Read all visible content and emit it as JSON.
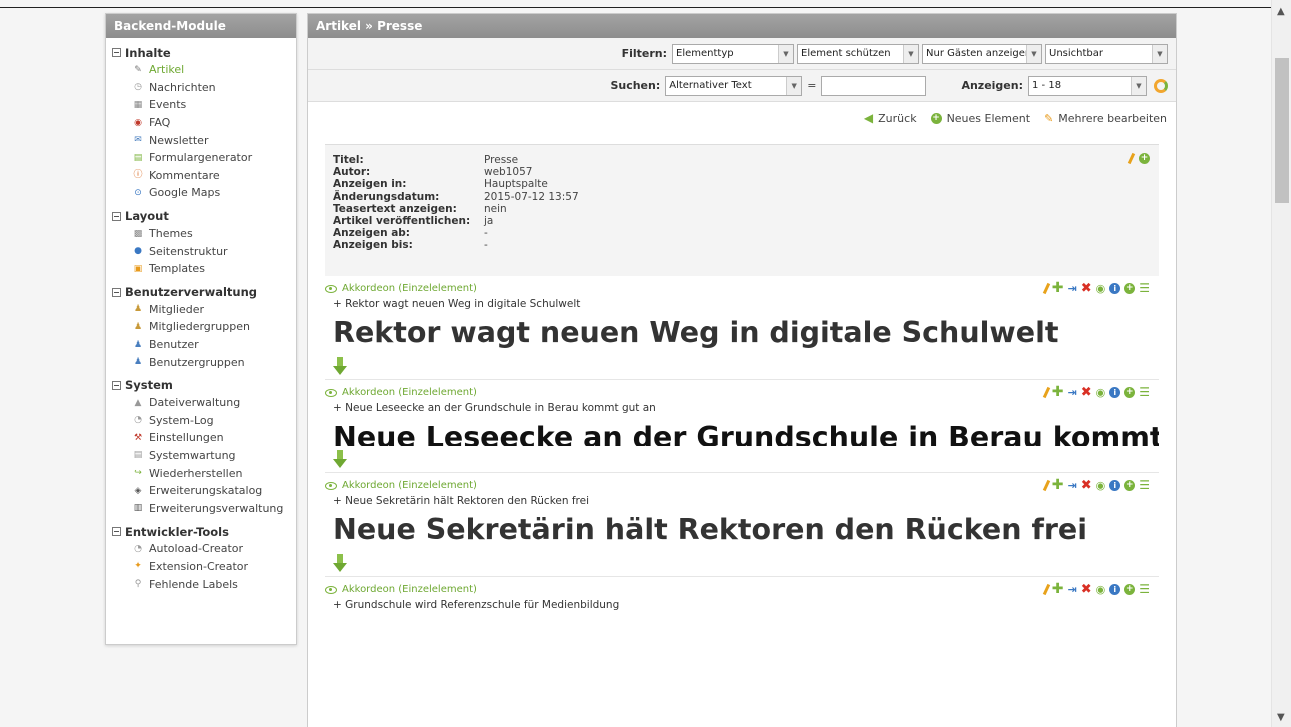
{
  "sidebar": {
    "title": "Backend-Module",
    "groups": [
      {
        "title": "Inhalte",
        "items": [
          {
            "label": "Artikel",
            "icon": "article-icon",
            "active": true
          },
          {
            "label": "Nachrichten",
            "icon": "news-icon"
          },
          {
            "label": "Events",
            "icon": "calendar-icon"
          },
          {
            "label": "FAQ",
            "icon": "faq-icon"
          },
          {
            "label": "Newsletter",
            "icon": "newsletter-icon"
          },
          {
            "label": "Formulargenerator",
            "icon": "form-icon"
          },
          {
            "label": "Kommentare",
            "icon": "comments-icon"
          },
          {
            "label": "Google Maps",
            "icon": "maps-icon"
          }
        ]
      },
      {
        "title": "Layout",
        "items": [
          {
            "label": "Themes",
            "icon": "themes-icon"
          },
          {
            "label": "Seitenstruktur",
            "icon": "site-structure-icon"
          },
          {
            "label": "Templates",
            "icon": "templates-icon"
          }
        ]
      },
      {
        "title": "Benutzerverwaltung",
        "items": [
          {
            "label": "Mitglieder",
            "icon": "member-icon"
          },
          {
            "label": "Mitgliedergruppen",
            "icon": "member-groups-icon"
          },
          {
            "label": "Benutzer",
            "icon": "user-icon"
          },
          {
            "label": "Benutzergruppen",
            "icon": "user-groups-icon"
          }
        ]
      },
      {
        "title": "System",
        "items": [
          {
            "label": "Dateiverwaltung",
            "icon": "files-icon"
          },
          {
            "label": "System-Log",
            "icon": "log-icon"
          },
          {
            "label": "Einstellungen",
            "icon": "settings-icon"
          },
          {
            "label": "Systemwartung",
            "icon": "maintenance-icon"
          },
          {
            "label": "Wiederherstellen",
            "icon": "restore-icon"
          },
          {
            "label": "Erweiterungskatalog",
            "icon": "extension-catalog-icon"
          },
          {
            "label": "Erweiterungsverwaltung",
            "icon": "extension-manager-icon"
          }
        ]
      },
      {
        "title": "Entwickler-Tools",
        "items": [
          {
            "label": "Autoload-Creator",
            "icon": "autoload-icon"
          },
          {
            "label": "Extension-Creator",
            "icon": "extension-creator-icon"
          },
          {
            "label": "Fehlende Labels",
            "icon": "labels-icon"
          }
        ]
      }
    ]
  },
  "main": {
    "title": "Artikel » Presse",
    "filter": {
      "label": "Filtern:",
      "selects": [
        "Elementtyp",
        "Element schützen",
        "Nur Gästen anzeigen",
        "Unsichtbar"
      ]
    },
    "search": {
      "label": "Suchen:",
      "field": "Alternativer Text",
      "equals": "=",
      "value": "",
      "show_label": "Anzeigen:",
      "show_value": "1 - 18"
    },
    "actions": {
      "back": "Zurück",
      "new": "Neues Element",
      "multi": "Mehrere bearbeiten"
    },
    "info": [
      {
        "key": "Titel:",
        "value": "Presse"
      },
      {
        "key": "Autor:",
        "value": "web1057"
      },
      {
        "key": "Anzeigen in:",
        "value": "Hauptspalte"
      },
      {
        "key": "Änderungsdatum:",
        "value": "2015-07-12 13:57"
      },
      {
        "key": "Teasertext anzeigen:",
        "value": "nein"
      },
      {
        "key": "Artikel veröffentlichen:",
        "value": "ja"
      },
      {
        "key": "Anzeigen ab:",
        "value": "-"
      },
      {
        "key": "Anzeigen bis:",
        "value": "-"
      }
    ],
    "elements": [
      {
        "type": "Akkordeon (Einzelelement)",
        "summary": "+ Rektor wagt neuen Weg in digitale Schulwelt",
        "headline": "Rektor wagt neuen Weg in digitale Schulwelt"
      },
      {
        "type": "Akkordeon (Einzelelement)",
        "summary": "+ Neue Leseecke an der Grundschule in Berau kommt gut an",
        "headline": "Neue Leseecke an der Grundschule in Berau kommt gut an"
      },
      {
        "type": "Akkordeon (Einzelelement)",
        "summary": "+ Neue Sekretärin hält Rektoren den Rücken frei",
        "headline": "Neue Sekretärin hält Rektoren den Rücken frei"
      },
      {
        "type": "Akkordeon (Einzelelement)",
        "summary": "+ Grundschule wird Referenzschule für Medienbildung",
        "headline": ""
      }
    ]
  }
}
